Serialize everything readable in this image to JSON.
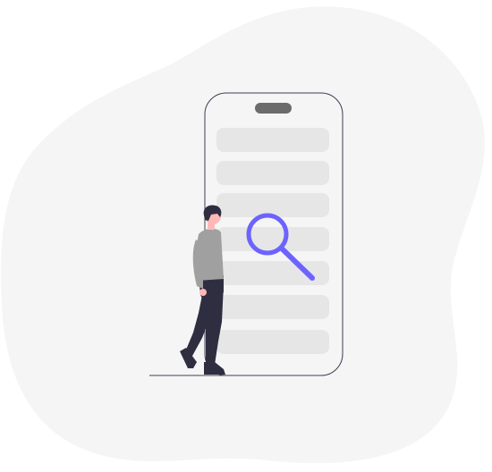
{
  "illustration": {
    "subject": "person-searching-mobile-list",
    "colors": {
      "page_background": "#ffffff",
      "blob_background": "#f5f5f5",
      "phone_outline": "#3f3d56",
      "phone_speaker": "#6b6b6b",
      "list_row": "#e6e6e6",
      "magnifier_accent": "#6c63ff",
      "person_skin": "#ffb8b8",
      "person_hair": "#2f2e41",
      "person_shirt": "#a0a0a0",
      "person_pants": "#2f2e41",
      "person_shoes": "#2f2e41",
      "ground_line": "#3f3d56"
    },
    "phone": {
      "list_rows_visible": 7
    },
    "icons": [
      "magnifying-glass-icon",
      "phone-speaker-icon"
    ]
  }
}
